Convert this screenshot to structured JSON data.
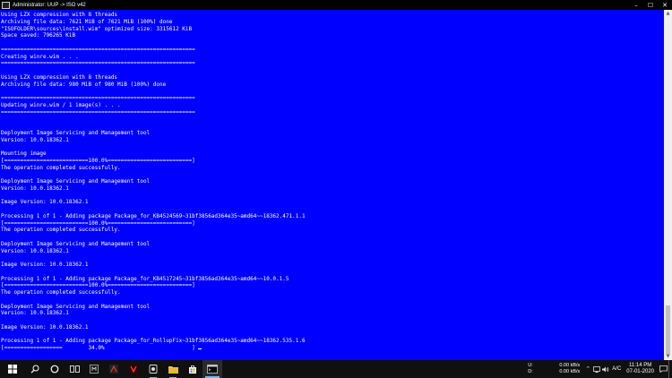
{
  "window": {
    "title": "Administrator: UUP -> ISO v42",
    "controls": [
      "–",
      "☐",
      "✕"
    ]
  },
  "console": {
    "lines": [
      "Using LZX compression with 8 threads",
      "Archiving file data: 7621 MiB of 7621 MiB (100%) done",
      "\"ISOFOLDER\\sources\\install.wim\" optimized size: 3315612 KiB",
      "Space saved: 796265 KiB",
      "",
      "============================================================",
      "Creating winre.wim . . .",
      "============================================================",
      "",
      "Using LZX compression with 8 threads",
      "Archiving file data: 980 MiB of 980 MiB (100%) done",
      "",
      "============================================================",
      "Updating winre.wim / 1 image(s) . . .",
      "============================================================",
      "",
      "",
      "Deployment Image Servicing and Management tool",
      "Version: 10.0.18362.1",
      "",
      "Mounting image",
      "[==========================100.0%==========================]",
      "The operation completed successfully.",
      "",
      "Deployment Image Servicing and Management tool",
      "Version: 10.0.18362.1",
      "",
      "Image Version: 10.0.18362.1",
      "",
      "Processing 1 of 1 - Adding package Package_for_KB4524569~31bf3856ad364e35~amd64~~18362.471.1.1",
      "[==========================100.0%==========================]",
      "The operation completed successfully.",
      "",
      "Deployment Image Servicing and Management tool",
      "Version: 10.0.18362.1",
      "",
      "Image Version: 10.0.18362.1",
      "",
      "Processing 1 of 1 - Adding package Package_for_KB4517245~31bf3856ad364e35~amd64~~10.0.1.5",
      "[==========================100.0%==========================]",
      "The operation completed successfully.",
      "",
      "Deployment Image Servicing and Management tool",
      "Version: 10.0.18362.1",
      "",
      "Image Version: 10.0.18362.1",
      "",
      "Processing 1 of 1 - Adding package Package_for_RollupFix~31bf3856ad364e35~amd64~~18362.535.1.6"
    ],
    "progress_line": "[==================        34.0%                           ] "
  },
  "taskbar": {
    "icons": [
      {
        "name": "windows-start-icon",
        "running": false,
        "active": false
      },
      {
        "name": "search-icon",
        "running": false,
        "active": false
      },
      {
        "name": "cortana-icon",
        "running": false,
        "active": false
      },
      {
        "name": "task-view-icon",
        "running": false,
        "active": false
      },
      {
        "name": "app-launcher-icon",
        "running": false,
        "active": false
      },
      {
        "name": "media-player-icon",
        "running": false,
        "active": false
      },
      {
        "name": "app-red-icon",
        "running": false,
        "active": false
      },
      {
        "name": "browser-icon",
        "running": true,
        "active": false
      },
      {
        "name": "file-explorer-icon",
        "running": true,
        "active": false
      },
      {
        "name": "store-icon",
        "running": false,
        "active": false
      },
      {
        "name": "command-prompt-icon",
        "running": true,
        "active": true
      }
    ],
    "network": {
      "upload_label": "U:",
      "upload_value": "0.00 kB/s",
      "download_label": "D:",
      "download_value": "0.00 kB/s"
    },
    "language": "A/C",
    "time": "11:14 PM",
    "date": "07-01-2020"
  },
  "colors": {
    "console_bg": "#0000ff",
    "console_fg": "#ffffff",
    "taskbar_bg": "#101010",
    "accent": "#76b9ed"
  }
}
